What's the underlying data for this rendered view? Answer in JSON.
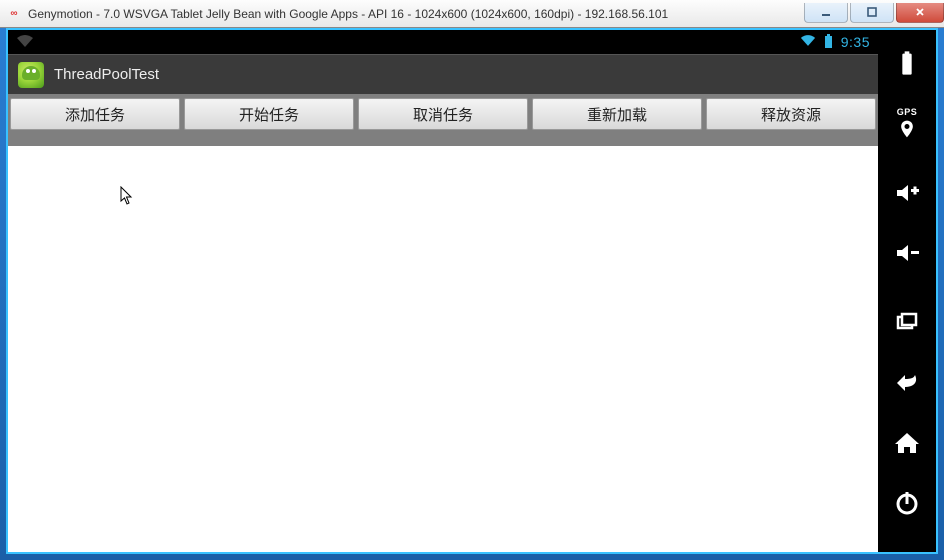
{
  "window": {
    "title": "Genymotion - 7.0 WSVGA Tablet Jelly Bean with Google Apps - API 16 - 1024x600 (1024x600, 160dpi) - 192.168.56.101"
  },
  "android_status": {
    "clock": "9:35"
  },
  "app": {
    "title": "ThreadPoolTest",
    "buttons": {
      "add": "添加任务",
      "start": "开始任务",
      "cancel": "取消任务",
      "reload": "重新加载",
      "release": "释放资源"
    }
  },
  "sidebar": {
    "gps_label": "GPS"
  }
}
